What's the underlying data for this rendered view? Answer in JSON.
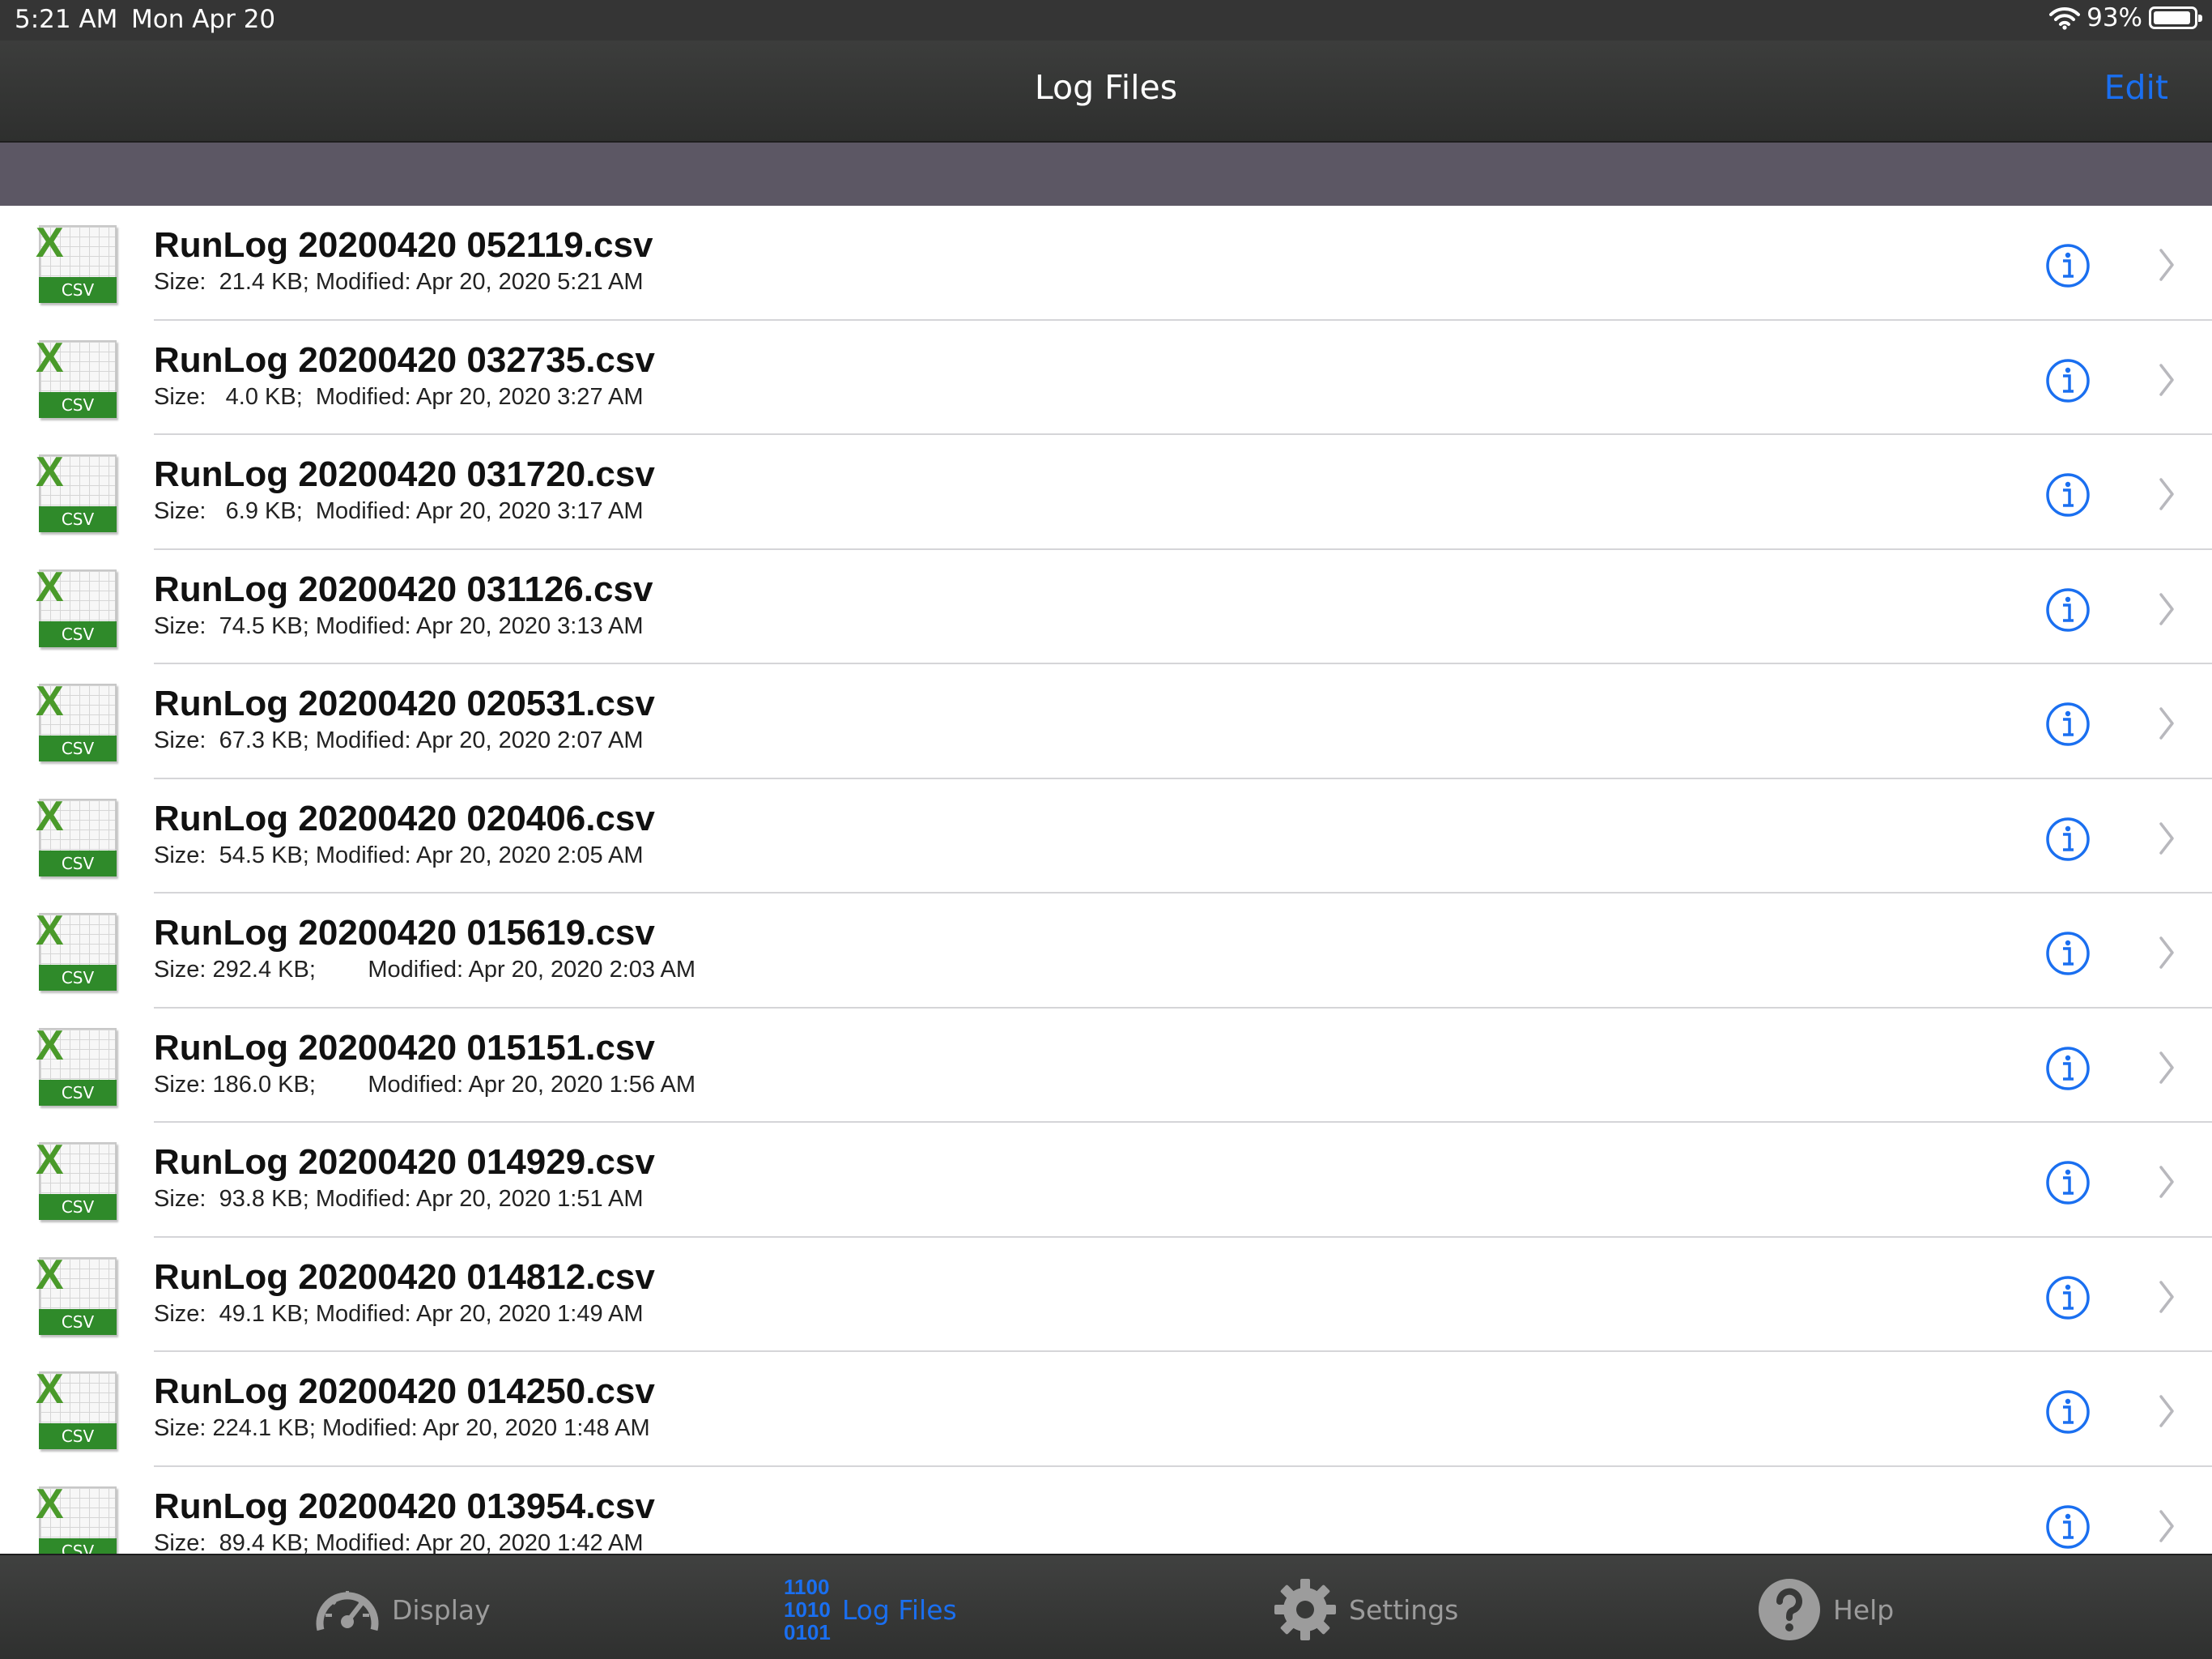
{
  "status_bar": {
    "time": "5:21 AM",
    "date": "Mon Apr 20",
    "battery": "93%",
    "battery_level": 0.93
  },
  "nav": {
    "title": "Log Files",
    "edit_label": "Edit"
  },
  "icons": {
    "file": "csv-file-icon",
    "info": "info-circle-icon",
    "chevron": "chevron-right-icon"
  },
  "file_icon": {
    "mark": "X",
    "badge": "CSV"
  },
  "files": [
    {
      "name": "RunLog 20200420 052119.csv",
      "meta": "Size:  21.4 KB; Modified: Apr 20, 2020 5:21 AM"
    },
    {
      "name": "RunLog 20200420 032735.csv",
      "meta": "Size:   4.0 KB;  Modified: Apr 20, 2020 3:27 AM"
    },
    {
      "name": "RunLog 20200420 031720.csv",
      "meta": "Size:   6.9 KB;  Modified: Apr 20, 2020 3:17 AM"
    },
    {
      "name": "RunLog 20200420 031126.csv",
      "meta": "Size:  74.5 KB; Modified: Apr 20, 2020 3:13 AM"
    },
    {
      "name": "RunLog 20200420 020531.csv",
      "meta": "Size:  67.3 KB; Modified: Apr 20, 2020 2:07 AM"
    },
    {
      "name": "RunLog 20200420 020406.csv",
      "meta": "Size:  54.5 KB; Modified: Apr 20, 2020 2:05 AM"
    },
    {
      "name": "RunLog 20200420 015619.csv",
      "meta": "Size: 292.4 KB;        Modified: Apr 20, 2020 2:03 AM"
    },
    {
      "name": "RunLog 20200420 015151.csv",
      "meta": "Size: 186.0 KB;        Modified: Apr 20, 2020 1:56 AM"
    },
    {
      "name": "RunLog 20200420 014929.csv",
      "meta": "Size:  93.8 KB; Modified: Apr 20, 2020 1:51 AM"
    },
    {
      "name": "RunLog 20200420 014812.csv",
      "meta": "Size:  49.1 KB; Modified: Apr 20, 2020 1:49 AM"
    },
    {
      "name": "RunLog 20200420 014250.csv",
      "meta": "Size: 224.1 KB; Modified: Apr 20, 2020 1:48 AM"
    },
    {
      "name": "RunLog 20200420 013954.csv",
      "meta": "Size:  89.4 KB; Modified: Apr 20, 2020 1:42 AM"
    }
  ],
  "tabs": [
    {
      "label": "Display",
      "icon": "speedometer-icon",
      "active": false
    },
    {
      "label": "Log Files",
      "icon": "binary-icon",
      "active": true,
      "glyph": [
        "1100",
        "1010",
        "0101"
      ]
    },
    {
      "label": "Settings",
      "icon": "gear-icon",
      "active": false
    },
    {
      "label": "Help",
      "icon": "question-icon",
      "active": false
    }
  ],
  "colors": {
    "accent": "#1a6ff0",
    "bar_background": "#353535",
    "subheader": "#5c5764",
    "inactive_tab": "#9c9c9c",
    "csv_green": "#2f8a2a"
  }
}
